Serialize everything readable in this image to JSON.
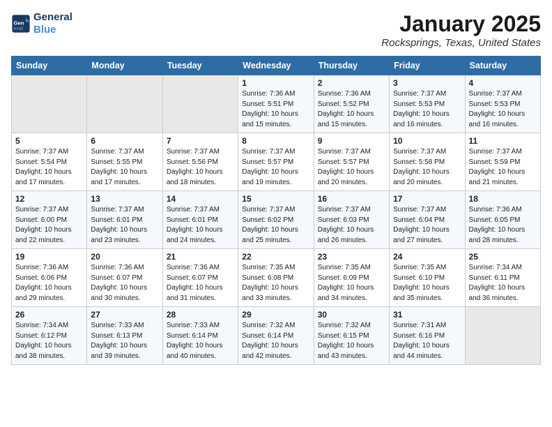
{
  "logo": {
    "line1": "General",
    "line2": "Blue"
  },
  "title": "January 2025",
  "location": "Rocksprings, Texas, United States",
  "weekdays": [
    "Sunday",
    "Monday",
    "Tuesday",
    "Wednesday",
    "Thursday",
    "Friday",
    "Saturday"
  ],
  "weeks": [
    [
      {
        "day": "",
        "sunrise": "",
        "sunset": "",
        "daylight": ""
      },
      {
        "day": "",
        "sunrise": "",
        "sunset": "",
        "daylight": ""
      },
      {
        "day": "",
        "sunrise": "",
        "sunset": "",
        "daylight": ""
      },
      {
        "day": "1",
        "sunrise": "Sunrise: 7:36 AM",
        "sunset": "Sunset: 5:51 PM",
        "daylight": "Daylight: 10 hours and 15 minutes."
      },
      {
        "day": "2",
        "sunrise": "Sunrise: 7:36 AM",
        "sunset": "Sunset: 5:52 PM",
        "daylight": "Daylight: 10 hours and 15 minutes."
      },
      {
        "day": "3",
        "sunrise": "Sunrise: 7:37 AM",
        "sunset": "Sunset: 5:53 PM",
        "daylight": "Daylight: 10 hours and 16 minutes."
      },
      {
        "day": "4",
        "sunrise": "Sunrise: 7:37 AM",
        "sunset": "Sunset: 5:53 PM",
        "daylight": "Daylight: 10 hours and 16 minutes."
      }
    ],
    [
      {
        "day": "5",
        "sunrise": "Sunrise: 7:37 AM",
        "sunset": "Sunset: 5:54 PM",
        "daylight": "Daylight: 10 hours and 17 minutes."
      },
      {
        "day": "6",
        "sunrise": "Sunrise: 7:37 AM",
        "sunset": "Sunset: 5:55 PM",
        "daylight": "Daylight: 10 hours and 17 minutes."
      },
      {
        "day": "7",
        "sunrise": "Sunrise: 7:37 AM",
        "sunset": "Sunset: 5:56 PM",
        "daylight": "Daylight: 10 hours and 18 minutes."
      },
      {
        "day": "8",
        "sunrise": "Sunrise: 7:37 AM",
        "sunset": "Sunset: 5:57 PM",
        "daylight": "Daylight: 10 hours and 19 minutes."
      },
      {
        "day": "9",
        "sunrise": "Sunrise: 7:37 AM",
        "sunset": "Sunset: 5:57 PM",
        "daylight": "Daylight: 10 hours and 20 minutes."
      },
      {
        "day": "10",
        "sunrise": "Sunrise: 7:37 AM",
        "sunset": "Sunset: 5:58 PM",
        "daylight": "Daylight: 10 hours and 20 minutes."
      },
      {
        "day": "11",
        "sunrise": "Sunrise: 7:37 AM",
        "sunset": "Sunset: 5:59 PM",
        "daylight": "Daylight: 10 hours and 21 minutes."
      }
    ],
    [
      {
        "day": "12",
        "sunrise": "Sunrise: 7:37 AM",
        "sunset": "Sunset: 6:00 PM",
        "daylight": "Daylight: 10 hours and 22 minutes."
      },
      {
        "day": "13",
        "sunrise": "Sunrise: 7:37 AM",
        "sunset": "Sunset: 6:01 PM",
        "daylight": "Daylight: 10 hours and 23 minutes."
      },
      {
        "day": "14",
        "sunrise": "Sunrise: 7:37 AM",
        "sunset": "Sunset: 6:01 PM",
        "daylight": "Daylight: 10 hours and 24 minutes."
      },
      {
        "day": "15",
        "sunrise": "Sunrise: 7:37 AM",
        "sunset": "Sunset: 6:02 PM",
        "daylight": "Daylight: 10 hours and 25 minutes."
      },
      {
        "day": "16",
        "sunrise": "Sunrise: 7:37 AM",
        "sunset": "Sunset: 6:03 PM",
        "daylight": "Daylight: 10 hours and 26 minutes."
      },
      {
        "day": "17",
        "sunrise": "Sunrise: 7:37 AM",
        "sunset": "Sunset: 6:04 PM",
        "daylight": "Daylight: 10 hours and 27 minutes."
      },
      {
        "day": "18",
        "sunrise": "Sunrise: 7:36 AM",
        "sunset": "Sunset: 6:05 PM",
        "daylight": "Daylight: 10 hours and 28 minutes."
      }
    ],
    [
      {
        "day": "19",
        "sunrise": "Sunrise: 7:36 AM",
        "sunset": "Sunset: 6:06 PM",
        "daylight": "Daylight: 10 hours and 29 minutes."
      },
      {
        "day": "20",
        "sunrise": "Sunrise: 7:36 AM",
        "sunset": "Sunset: 6:07 PM",
        "daylight": "Daylight: 10 hours and 30 minutes."
      },
      {
        "day": "21",
        "sunrise": "Sunrise: 7:36 AM",
        "sunset": "Sunset: 6:07 PM",
        "daylight": "Daylight: 10 hours and 31 minutes."
      },
      {
        "day": "22",
        "sunrise": "Sunrise: 7:35 AM",
        "sunset": "Sunset: 6:08 PM",
        "daylight": "Daylight: 10 hours and 33 minutes."
      },
      {
        "day": "23",
        "sunrise": "Sunrise: 7:35 AM",
        "sunset": "Sunset: 6:09 PM",
        "daylight": "Daylight: 10 hours and 34 minutes."
      },
      {
        "day": "24",
        "sunrise": "Sunrise: 7:35 AM",
        "sunset": "Sunset: 6:10 PM",
        "daylight": "Daylight: 10 hours and 35 minutes."
      },
      {
        "day": "25",
        "sunrise": "Sunrise: 7:34 AM",
        "sunset": "Sunset: 6:11 PM",
        "daylight": "Daylight: 10 hours and 36 minutes."
      }
    ],
    [
      {
        "day": "26",
        "sunrise": "Sunrise: 7:34 AM",
        "sunset": "Sunset: 6:12 PM",
        "daylight": "Daylight: 10 hours and 38 minutes."
      },
      {
        "day": "27",
        "sunrise": "Sunrise: 7:33 AM",
        "sunset": "Sunset: 6:13 PM",
        "daylight": "Daylight: 10 hours and 39 minutes."
      },
      {
        "day": "28",
        "sunrise": "Sunrise: 7:33 AM",
        "sunset": "Sunset: 6:14 PM",
        "daylight": "Daylight: 10 hours and 40 minutes."
      },
      {
        "day": "29",
        "sunrise": "Sunrise: 7:32 AM",
        "sunset": "Sunset: 6:14 PM",
        "daylight": "Daylight: 10 hours and 42 minutes."
      },
      {
        "day": "30",
        "sunrise": "Sunrise: 7:32 AM",
        "sunset": "Sunset: 6:15 PM",
        "daylight": "Daylight: 10 hours and 43 minutes."
      },
      {
        "day": "31",
        "sunrise": "Sunrise: 7:31 AM",
        "sunset": "Sunset: 6:16 PM",
        "daylight": "Daylight: 10 hours and 44 minutes."
      },
      {
        "day": "",
        "sunrise": "",
        "sunset": "",
        "daylight": ""
      }
    ]
  ]
}
